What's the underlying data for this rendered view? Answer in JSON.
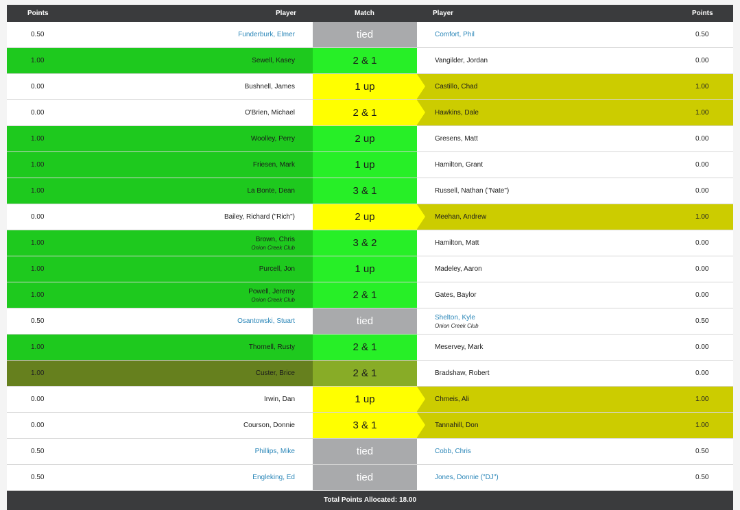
{
  "header": {
    "points_left": "Points",
    "player_left": "Player",
    "match": "Match",
    "player_right": "Player",
    "points_right": "Points"
  },
  "colors": {
    "green": "#1ec91e",
    "match_green": "#27ef27",
    "olive_left": "#66801e",
    "olive_match": "#88ac27",
    "yellow_match": "#ffff00",
    "right_win": "#cccc00",
    "tied": "#a9aaac"
  },
  "rows": [
    {
      "lp": "0.50",
      "ln": "Funderburk, Elmer",
      "lc": "",
      "res": "tied",
      "rn": "Comfort, Phil",
      "rc": "",
      "rp": "0.50",
      "w": "T"
    },
    {
      "lp": "1.00",
      "ln": "Sewell, Kasey",
      "lc": "",
      "res": "2 & 1",
      "rn": "Vangilder, Jordan",
      "rc": "",
      "rp": "0.00",
      "w": "L"
    },
    {
      "lp": "0.00",
      "ln": "Bushnell, James",
      "lc": "",
      "res": "1 up",
      "rn": "Castillo, Chad",
      "rc": "",
      "rp": "1.00",
      "w": "R"
    },
    {
      "lp": "0.00",
      "ln": "O'Brien, Michael",
      "lc": "",
      "res": "2 & 1",
      "rn": "Hawkins, Dale",
      "rc": "",
      "rp": "1.00",
      "w": "R"
    },
    {
      "lp": "1.00",
      "ln": "Woolley, Perry",
      "lc": "",
      "res": "2 up",
      "rn": "Gresens, Matt",
      "rc": "",
      "rp": "0.00",
      "w": "L"
    },
    {
      "lp": "1.00",
      "ln": "Friesen, Mark",
      "lc": "",
      "res": "1 up",
      "rn": "Hamilton, Grant",
      "rc": "",
      "rp": "0.00",
      "w": "L"
    },
    {
      "lp": "1.00",
      "ln": "La Bonte, Dean",
      "lc": "",
      "res": "3 & 1",
      "rn": "Russell, Nathan (\"Nate\")",
      "rc": "",
      "rp": "0.00",
      "w": "L"
    },
    {
      "lp": "0.00",
      "ln": "Bailey, Richard (\"Rich\")",
      "lc": "",
      "res": "2 up",
      "rn": "Meehan, Andrew",
      "rc": "",
      "rp": "1.00",
      "w": "R"
    },
    {
      "lp": "1.00",
      "ln": "Brown, Chris",
      "lc": "Onion Creek Club",
      "res": "3 & 2",
      "rn": "Hamilton, Matt",
      "rc": "",
      "rp": "0.00",
      "w": "L"
    },
    {
      "lp": "1.00",
      "ln": "Purcell, Jon",
      "lc": "",
      "res": "1 up",
      "rn": "Madeley, Aaron",
      "rc": "",
      "rp": "0.00",
      "w": "L"
    },
    {
      "lp": "1.00",
      "ln": "Powell, Jeremy",
      "lc": "Onion Creek Club",
      "res": "2 & 1",
      "rn": "Gates, Baylor",
      "rc": "",
      "rp": "0.00",
      "w": "L"
    },
    {
      "lp": "0.50",
      "ln": "Osantowski, Stuart",
      "lc": "",
      "res": "tied",
      "rn": "Shelton, Kyle",
      "rc": "Onion Creek Club",
      "rp": "0.50",
      "w": "T"
    },
    {
      "lp": "1.00",
      "ln": "Thornell, Rusty",
      "lc": "",
      "res": "2 & 1",
      "rn": "Meservey, Mark",
      "rc": "",
      "rp": "0.00",
      "w": "L"
    },
    {
      "lp": "1.00",
      "ln": "Custer, Brice",
      "lc": "",
      "res": "2 & 1",
      "rn": "Bradshaw, Robert",
      "rc": "",
      "rp": "0.00",
      "w": "O"
    },
    {
      "lp": "0.00",
      "ln": "Irwin, Dan",
      "lc": "",
      "res": "1 up",
      "rn": "Chmeis, Ali",
      "rc": "",
      "rp": "1.00",
      "w": "R"
    },
    {
      "lp": "0.00",
      "ln": "Courson, Donnie",
      "lc": "",
      "res": "3 & 1",
      "rn": "Tannahill, Don",
      "rc": "",
      "rp": "1.00",
      "w": "R"
    },
    {
      "lp": "0.50",
      "ln": "Phillips, Mike",
      "lc": "",
      "res": "tied",
      "rn": "Cobb, Chris",
      "rc": "",
      "rp": "0.50",
      "w": "T"
    },
    {
      "lp": "0.50",
      "ln": "Engleking, Ed",
      "lc": "",
      "res": "tied",
      "rn": "Jones, Donnie (\"DJ\")",
      "rc": "",
      "rp": "0.50",
      "w": "T"
    }
  ],
  "footer": {
    "total": "Total Points Allocated: 18.00"
  }
}
